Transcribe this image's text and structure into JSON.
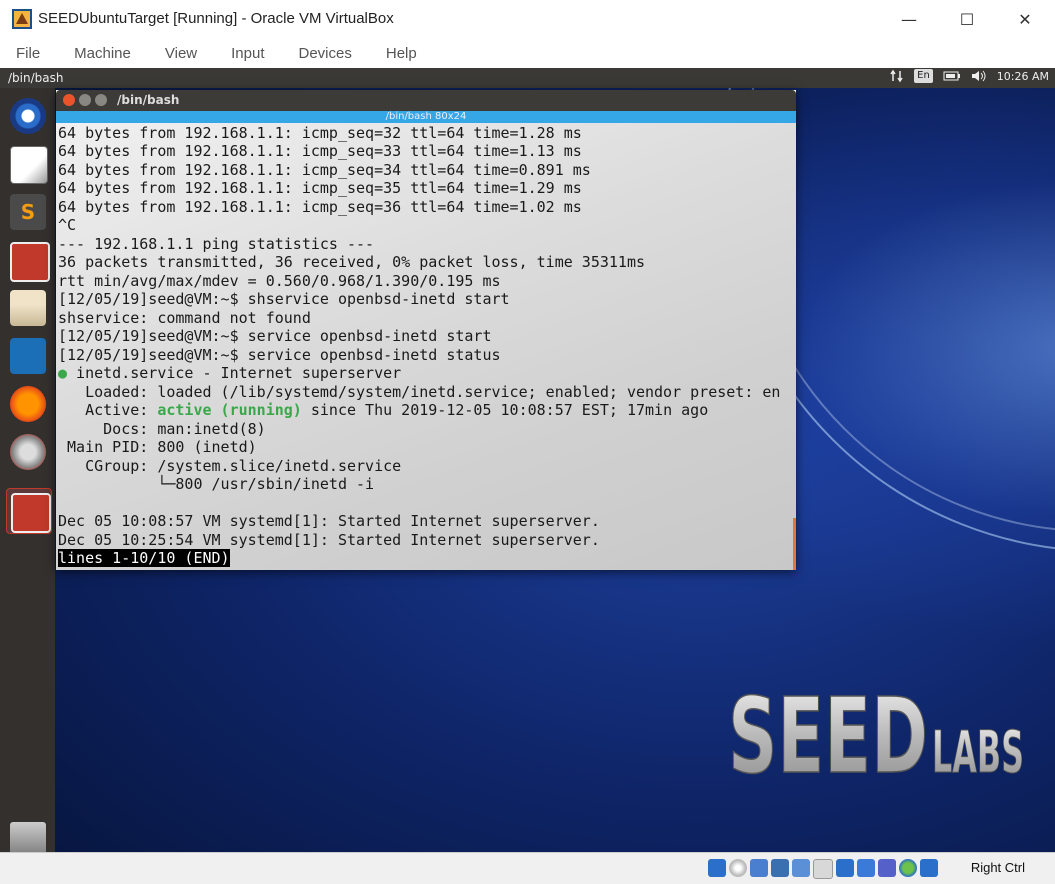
{
  "window": {
    "title": "SEEDUbuntuTarget [Running] - Oracle VM VirtualBox",
    "minimize": "—",
    "maximize": "☐",
    "close": "✕"
  },
  "menu": [
    "File",
    "Machine",
    "View",
    "Input",
    "Devices",
    "Help"
  ],
  "guest_panel": {
    "title": "/bin/bash",
    "lang": "En",
    "time": "10:26 AM"
  },
  "terminal": {
    "title": "/bin/bash",
    "tab_label": "/bin/bash 80x24",
    "lines": [
      "64 bytes from 192.168.1.1: icmp_seq=32 ttl=64 time=1.28 ms",
      "64 bytes from 192.168.1.1: icmp_seq=33 ttl=64 time=1.13 ms",
      "64 bytes from 192.168.1.1: icmp_seq=34 ttl=64 time=0.891 ms",
      "64 bytes from 192.168.1.1: icmp_seq=35 ttl=64 time=1.29 ms",
      "64 bytes from 192.168.1.1: icmp_seq=36 ttl=64 time=1.02 ms",
      "^C",
      "--- 192.168.1.1 ping statistics ---",
      "36 packets transmitted, 36 received, 0% packet loss, time 35311ms",
      "rtt min/avg/max/mdev = 0.560/0.968/1.390/0.195 ms",
      "[12/05/19]seed@VM:~$ shservice openbsd-inetd start",
      "shservice: command not found",
      "[12/05/19]seed@VM:~$ service openbsd-inetd start",
      "[12/05/19]seed@VM:~$ service openbsd-inetd status"
    ],
    "status_dot": "●",
    "status_head": " inetd.service - Internet superserver",
    "loaded_line": "   Loaded: loaded (/lib/systemd/system/inetd.service; enabled; vendor preset: en",
    "active_prefix": "   Active: ",
    "active_state": "active (running)",
    "active_suffix": " since Thu 2019-12-05 10:08:57 EST; 17min ago",
    "docs_line": "     Docs: man:inetd(8)",
    "pid_line": " Main PID: 800 (inetd)",
    "cgroup_line": "   CGroup: /system.slice/inetd.service",
    "cgroup_child": "           └─800 /usr/sbin/inetd -i",
    "log_lines": [
      "Dec 05 10:08:57 VM systemd[1]: Started Internet superserver.",
      "Dec 05 10:25:54 VM systemd[1]: Started Internet superserver."
    ],
    "pager": "lines 1-10/10 (END)"
  },
  "logo_text": "SEEDLABS",
  "statusbar": {
    "host_key": "Right Ctrl"
  },
  "colors": {
    "terminal_tab": "#35a6e6",
    "active_green": "#3aa84a",
    "guest_panel": "#3a3935",
    "launcher": "#33302e"
  }
}
